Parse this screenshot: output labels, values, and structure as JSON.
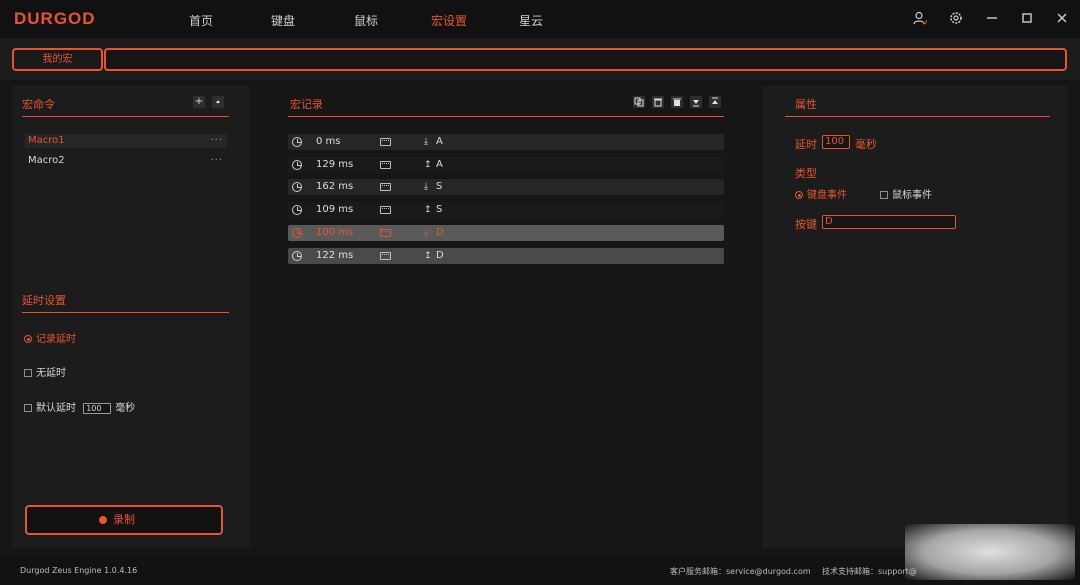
{
  "app": {
    "logo": "DURGOD"
  },
  "nav": [
    {
      "label": "首页"
    },
    {
      "label": "键盘"
    },
    {
      "label": "鼠标"
    },
    {
      "label": "宏设置",
      "active": true
    },
    {
      "label": "星云"
    }
  ],
  "window_icons": [
    "user-settings-icon",
    "gear-icon",
    "minimize-icon",
    "maximize-icon",
    "close-icon"
  ],
  "macro_bar": {
    "my_macro_label": "我的宏",
    "name_value": ""
  },
  "macro_commands": {
    "title": "宏命令",
    "items": [
      {
        "name": "Macro1",
        "selected": true,
        "more": "···"
      },
      {
        "name": "Macro2",
        "selected": false,
        "more": "···"
      }
    ]
  },
  "delay_settings": {
    "title": "延时设置",
    "options": [
      {
        "label": "记录延时",
        "checked": true
      },
      {
        "label": "无延时",
        "checked": false
      },
      {
        "label": "默认延时",
        "checked": false,
        "value": "100",
        "unit": "毫秒"
      }
    ]
  },
  "record_button": {
    "label": "录制"
  },
  "macro_record": {
    "title": "宏记录",
    "rows": [
      {
        "time": "0 ms",
        "direction": "down",
        "key": "A",
        "state": "normal"
      },
      {
        "time": "129 ms",
        "direction": "up",
        "key": "A",
        "state": "alt"
      },
      {
        "time": "162 ms",
        "direction": "down",
        "key": "S",
        "state": "normal"
      },
      {
        "time": "109 ms",
        "direction": "up",
        "key": "S",
        "state": "alt"
      },
      {
        "time": "100 ms",
        "direction": "down",
        "key": "D",
        "state": "selected"
      },
      {
        "time": "122 ms",
        "direction": "up",
        "key": "D",
        "state": "highlight"
      }
    ]
  },
  "properties": {
    "title": "属性",
    "delay_label": "延时",
    "delay_value": "100",
    "delay_unit": "毫秒",
    "type_label": "类型",
    "type_options": [
      {
        "label": "键盘事件",
        "checked": true
      },
      {
        "label": "鼠标事件",
        "checked": false
      }
    ],
    "key_label": "按键",
    "key_value": "D"
  },
  "footer": {
    "version": "Durgod Zeus Engine 1.0.4.16",
    "service": "客户服务邮箱：service@durgod.com",
    "support": "技术支持邮箱：support@"
  },
  "colors": {
    "accent": "#e8552d",
    "background": "#151515",
    "panel": "#1c1c1c"
  }
}
